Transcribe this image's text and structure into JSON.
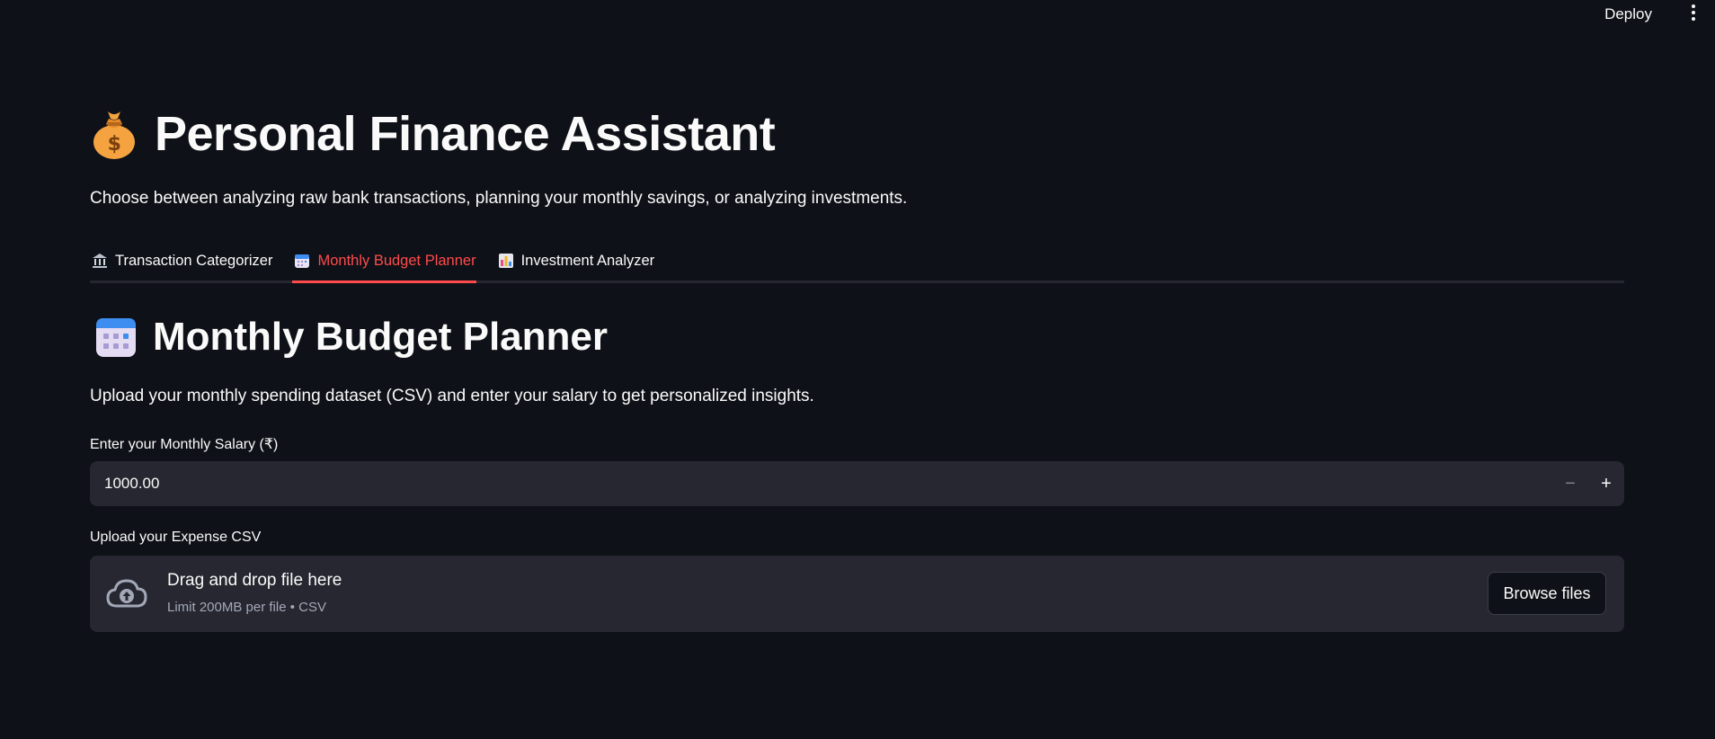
{
  "topbar": {
    "deploy_label": "Deploy",
    "menu_icon": "kebab-menu-icon"
  },
  "header": {
    "title": "Personal Finance Assistant",
    "title_icon": "money-bag-icon",
    "subtitle": "Choose between analyzing raw bank transactions, planning your monthly savings, or analyzing investments."
  },
  "tabs": [
    {
      "label": "Transaction Categorizer",
      "icon": "bank-icon",
      "active": false
    },
    {
      "label": "Monthly Budget Planner",
      "icon": "calendar-icon",
      "active": true
    },
    {
      "label": "Investment Analyzer",
      "icon": "bar-chart-icon",
      "active": false
    }
  ],
  "section": {
    "title": "Monthly Budget Planner",
    "icon": "calendar-icon",
    "description": "Upload your monthly spending dataset (CSV) and enter your salary to get personalized insights."
  },
  "salary": {
    "label": "Enter your Monthly Salary (₹)",
    "value": "1000.00",
    "decrement": "−",
    "increment": "+"
  },
  "upload": {
    "label": "Upload your Expense CSV",
    "drag_text": "Drag and drop file here",
    "limit_text": "Limit 200MB per file • CSV",
    "browse_label": "Browse files",
    "icon": "cloud-upload-icon"
  },
  "colors": {
    "background": "#0e1117",
    "accent": "#ff4b4b",
    "input_bg": "#262730"
  }
}
